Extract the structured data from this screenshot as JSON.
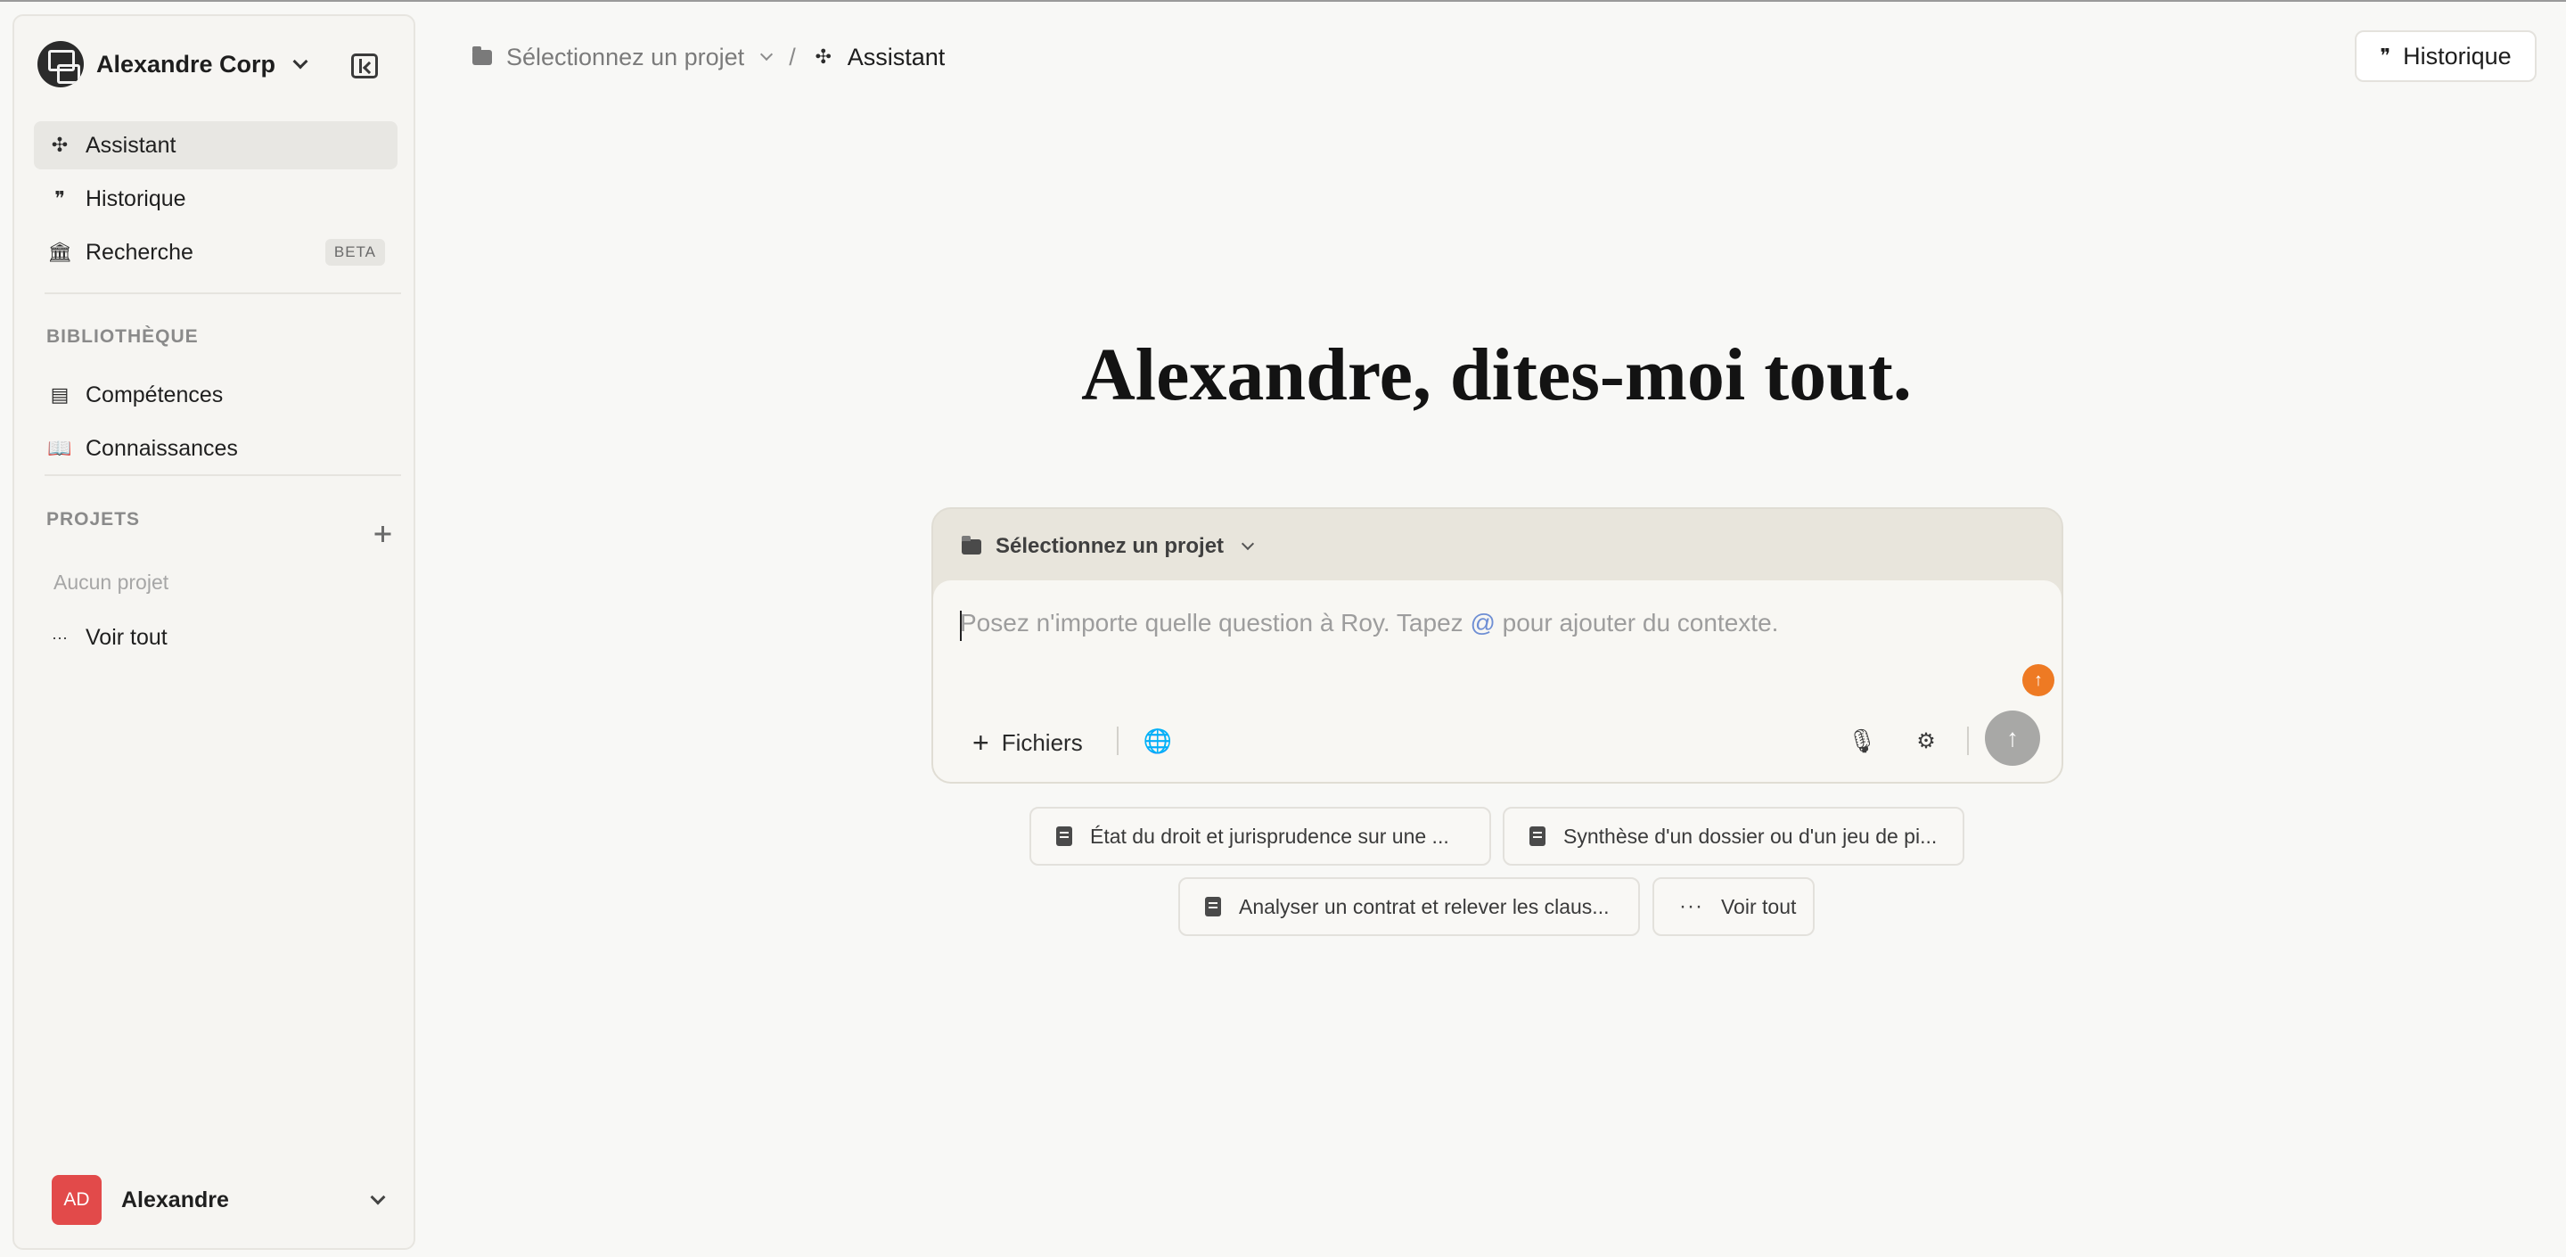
{
  "sidebar": {
    "org_name": "Alexandre Corp",
    "nav": [
      {
        "label": "Assistant",
        "icon": "assistant-icon"
      },
      {
        "label": "Historique",
        "icon": "chat-history-icon"
      },
      {
        "label": "Recherche",
        "icon": "bank-icon",
        "badge": "BETA"
      }
    ],
    "library_label": "BIBLIOTHÈQUE",
    "library": [
      {
        "label": "Compétences",
        "icon": "book-icon"
      },
      {
        "label": "Connaissances",
        "icon": "open-book-icon"
      }
    ],
    "projects_label": "PROJETS",
    "no_project": "Aucun projet",
    "see_all": "Voir tout",
    "user": {
      "initials": "AD",
      "name": "Alexandre"
    }
  },
  "topbar": {
    "project_crumb": "Sélectionnez un projet",
    "separator": "/",
    "current": "Assistant",
    "history_button": "Historique"
  },
  "hero": {
    "title": "Alexandre, dites-moi tout."
  },
  "composer": {
    "project_select": "Sélectionnez un projet",
    "placeholder_before": "Posez n'importe quelle question à Roy. Tapez ",
    "placeholder_at": "@",
    "placeholder_after": " pour ajouter du contexte.",
    "files_label": "Fichiers"
  },
  "suggestions": [
    {
      "label": "État du droit et jurisprudence sur une ..."
    },
    {
      "label": "Synthèse d'un dossier ou d'un jeu de pi..."
    },
    {
      "label": "Analyser un contrat et relever les claus..."
    },
    {
      "label": "Voir tout"
    }
  ],
  "colors": {
    "accent": "#ee7a23",
    "avatar": "#e24a4a",
    "background": "#f8f8f6"
  }
}
